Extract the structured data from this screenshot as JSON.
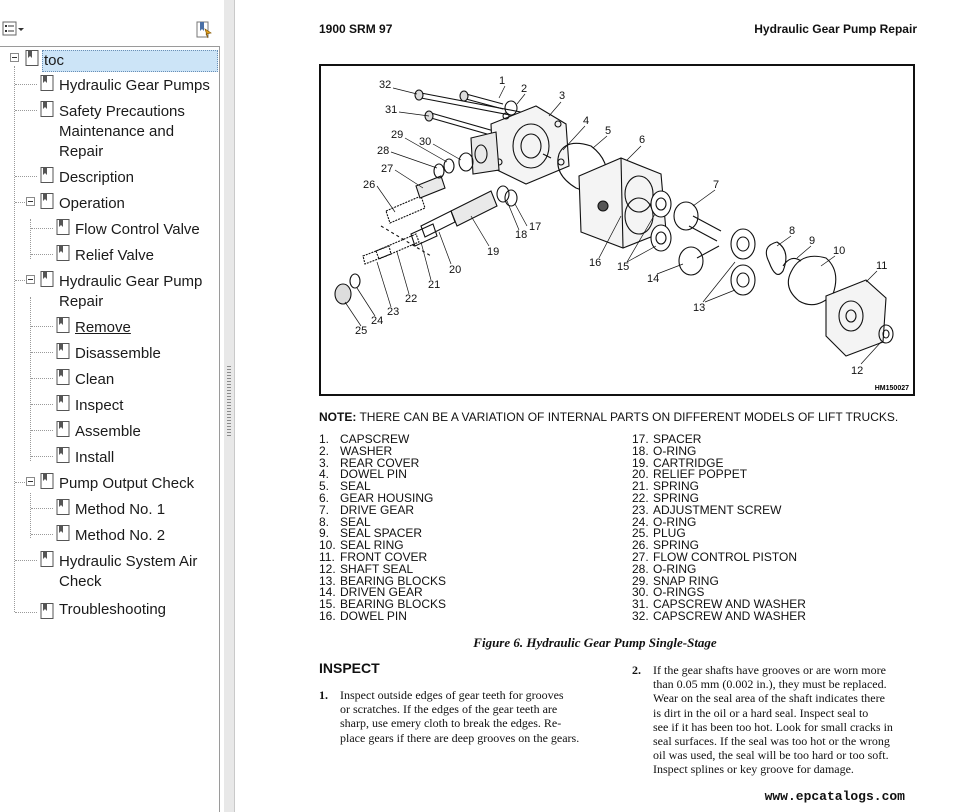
{
  "toc": {
    "items": [
      {
        "label": "toc"
      },
      {
        "label": "Hydraulic Gear Pumps"
      },
      {
        "label": "Safety Precautions Maintenance and Repair"
      },
      {
        "label": "Description"
      },
      {
        "label": "Operation"
      },
      {
        "label": "Flow Control Valve"
      },
      {
        "label": "Relief Valve"
      },
      {
        "label": "Hydraulic Gear Pump Repair"
      },
      {
        "label": "Remove"
      },
      {
        "label": "Disassemble"
      },
      {
        "label": "Clean"
      },
      {
        "label": "Inspect"
      },
      {
        "label": "Assemble"
      },
      {
        "label": "Install"
      },
      {
        "label": "Pump Output Check"
      },
      {
        "label": "Method No. 1"
      },
      {
        "label": "Method No. 2"
      },
      {
        "label": "Hydraulic System Air Check"
      },
      {
        "label": "Troubleshooting"
      }
    ]
  },
  "document": {
    "header_left": "1900 SRM 97",
    "header_right": "Hydraulic Gear Pump Repair",
    "figure_id": "HM150027",
    "callouts": [
      "1",
      "2",
      "3",
      "4",
      "5",
      "6",
      "7",
      "8",
      "9",
      "10",
      "11",
      "12",
      "13",
      "14",
      "15",
      "16",
      "17",
      "18",
      "19",
      "20",
      "21",
      "22",
      "23",
      "24",
      "25",
      "26",
      "27",
      "28",
      "29",
      "30",
      "31",
      "32"
    ],
    "note_label": "NOTE:",
    "note_text": " THERE CAN BE A VARIATION OF INTERNAL PARTS ON DIFFERENT MODELS OF LIFT TRUCKS.",
    "parts_left": [
      {
        "num": "1.",
        "name": "CAPSCREW"
      },
      {
        "num": "2.",
        "name": "WASHER"
      },
      {
        "num": "3.",
        "name": "REAR COVER"
      },
      {
        "num": "4.",
        "name": "DOWEL PIN"
      },
      {
        "num": "5.",
        "name": "SEAL"
      },
      {
        "num": "6.",
        "name": "GEAR HOUSING"
      },
      {
        "num": "7.",
        "name": "DRIVE GEAR"
      },
      {
        "num": "8.",
        "name": "SEAL"
      },
      {
        "num": "9.",
        "name": "SEAL SPACER"
      },
      {
        "num": "10.",
        "name": "SEAL RING"
      },
      {
        "num": "11.",
        "name": "FRONT COVER"
      },
      {
        "num": "12.",
        "name": "SHAFT SEAL"
      },
      {
        "num": "13.",
        "name": "BEARING BLOCKS"
      },
      {
        "num": "14.",
        "name": "DRIVEN GEAR"
      },
      {
        "num": "15.",
        "name": "BEARING BLOCKS"
      },
      {
        "num": "16.",
        "name": "DOWEL PIN"
      }
    ],
    "parts_right": [
      {
        "num": "17.",
        "name": "SPACER"
      },
      {
        "num": "18.",
        "name": "O-RING"
      },
      {
        "num": "19.",
        "name": "CARTRIDGE"
      },
      {
        "num": "20.",
        "name": "RELIEF POPPET"
      },
      {
        "num": "21.",
        "name": "SPRING"
      },
      {
        "num": "22.",
        "name": "SPRING"
      },
      {
        "num": "23.",
        "name": "ADJUSTMENT SCREW"
      },
      {
        "num": "24.",
        "name": "O-RING"
      },
      {
        "num": "25.",
        "name": "PLUG"
      },
      {
        "num": "26.",
        "name": "SPRING"
      },
      {
        "num": "27.",
        "name": "FLOW CONTROL PISTON"
      },
      {
        "num": "28.",
        "name": "O-RING"
      },
      {
        "num": "29.",
        "name": "SNAP RING"
      },
      {
        "num": "30.",
        "name": "O-RINGS"
      },
      {
        "num": "31.",
        "name": "CAPSCREW AND WASHER"
      },
      {
        "num": "32.",
        "name": "CAPSCREW AND WASHER"
      }
    ],
    "figure_caption": "Figure 6.  Hydraulic Gear Pump Single-Stage",
    "section_heading": "INSPECT",
    "step1_num": "1.",
    "step1_lines": [
      "Inspect outside edges of gear teeth for grooves",
      "or scratches.  If the edges of the gear teeth are",
      "sharp, use emery cloth to break the edges.  Re-",
      "place gears if there are deep grooves on the gears."
    ],
    "step2_num": "2.",
    "step2_lines": [
      "If the gear shafts have grooves or are worn more",
      "than 0.05 mm (0.002 in.), they must be replaced.",
      "Wear on the seal area of the shaft indicates there",
      "is dirt in the oil or a hard seal.  Inspect seal to",
      "see if it has been too hot.  Look for small cracks in",
      "seal surfaces.  If the seal was too hot or the wrong",
      "oil was used, the seal will be too hard or too soft.",
      "Inspect splines or key groove for damage."
    ],
    "watermark": "www.epcatalogs.com"
  }
}
